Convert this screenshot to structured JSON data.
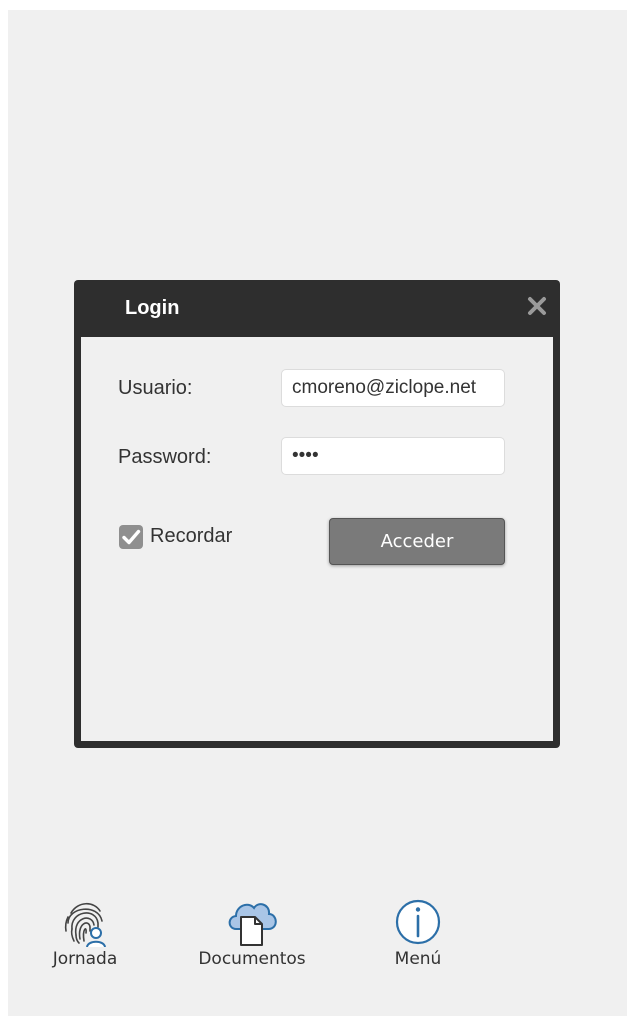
{
  "login_dialog": {
    "title": "Login",
    "close_icon": "close-icon",
    "username_label": "Usuario:",
    "username_value": "cmoreno@ziclope.net",
    "password_label": "Password:",
    "password_value": "••••",
    "remember_label": "Recordar",
    "remember_checked": true,
    "submit_label": "Acceder"
  },
  "bottom_nav": {
    "items": [
      {
        "label": "Jornada",
        "icon": "fingerprint-user-icon"
      },
      {
        "label": "Documentos",
        "icon": "cloud-document-icon"
      },
      {
        "label": "Menú",
        "icon": "info-icon"
      }
    ]
  },
  "colors": {
    "background": "#f0f0f0",
    "dialog_frame": "#2e2e2e",
    "button": "#7a7a7a",
    "icon_blue": "#2c6fa8",
    "cloud_blue": "#a9c5e6"
  }
}
